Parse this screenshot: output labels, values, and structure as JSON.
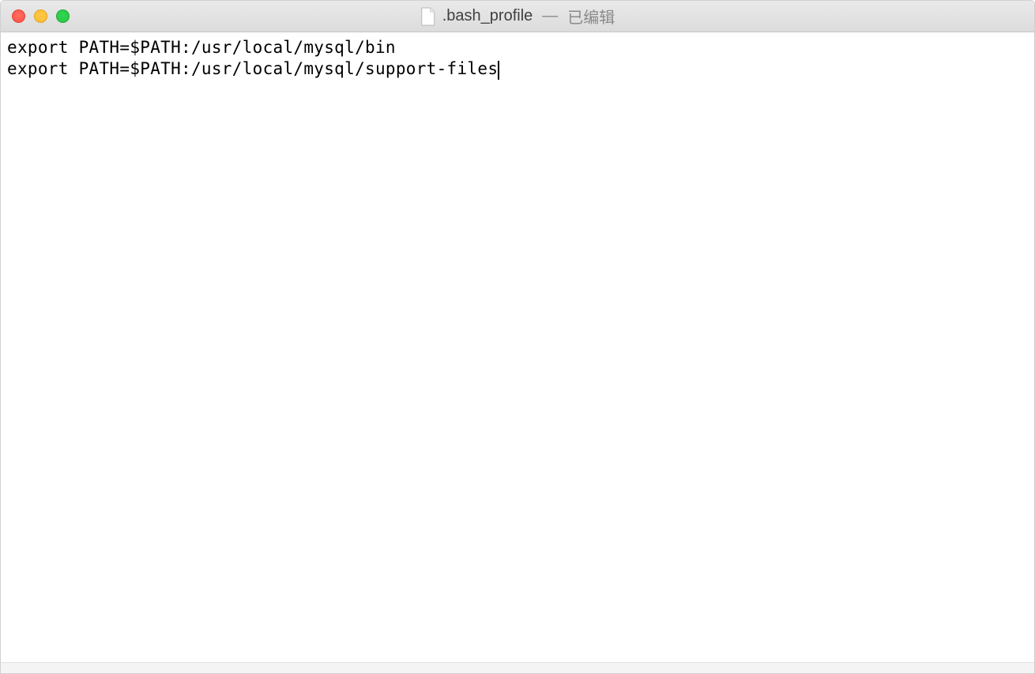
{
  "titlebar": {
    "filename": ".bash_profile",
    "separator": "—",
    "status": "已编辑"
  },
  "editor": {
    "lines": [
      "export PATH=$PATH:/usr/local/mysql/bin",
      "export PATH=$PATH:/usr/local/mysql/support-files"
    ]
  }
}
